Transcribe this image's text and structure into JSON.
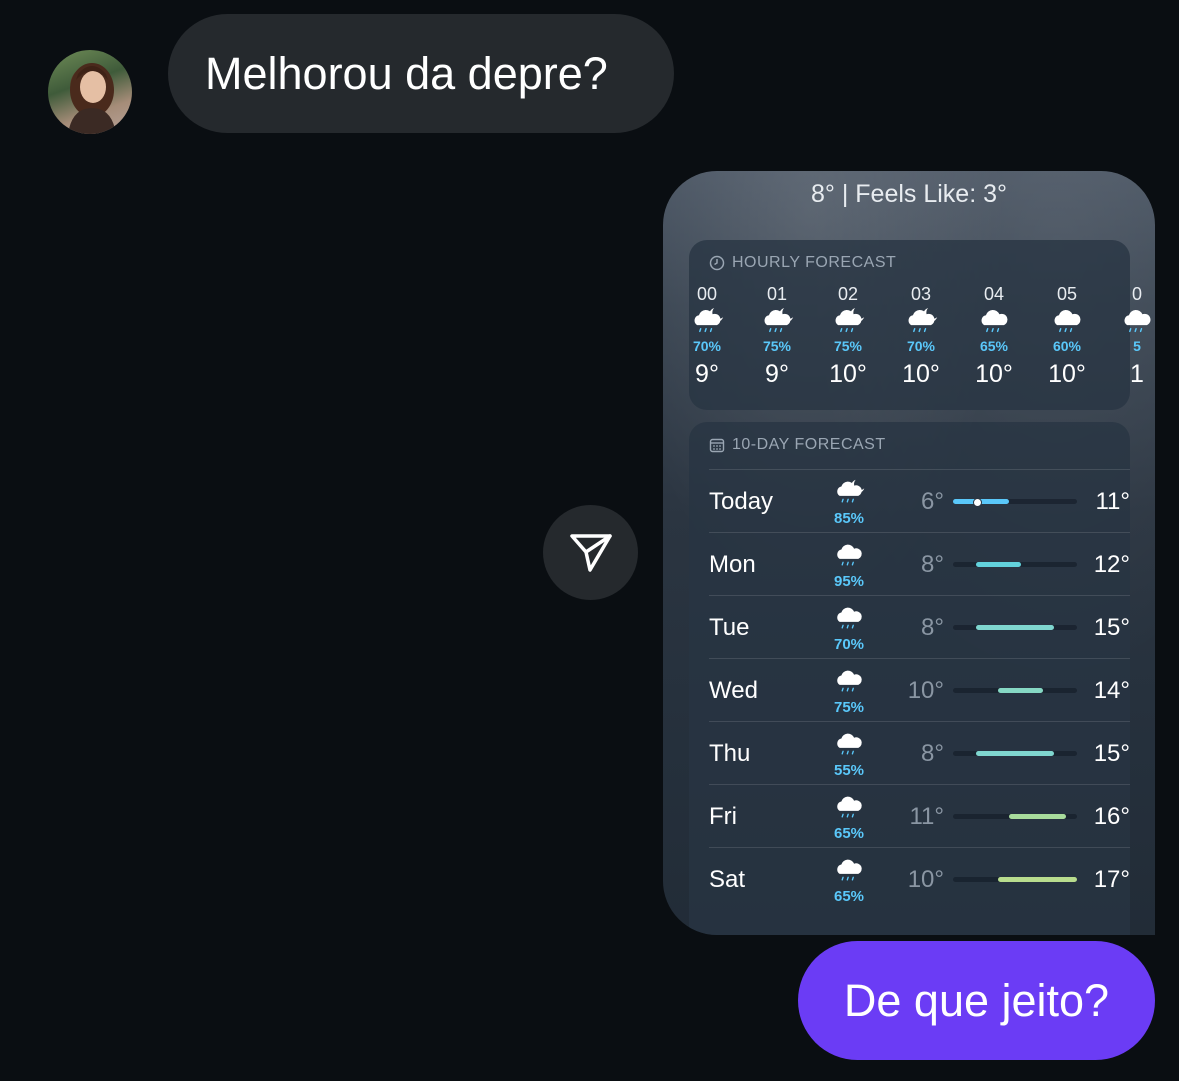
{
  "incoming_message": {
    "text": "Melhorou da depre?"
  },
  "outgoing_message": {
    "text": "De que jeito?"
  },
  "weather_card": {
    "current": "8° | Feels Like: 3°",
    "hourly": {
      "title": "HOURLY FORECAST",
      "items": [
        {
          "time": "00",
          "icon": "cloud-moon-rain-icon",
          "precip": "70%",
          "temp": "9°"
        },
        {
          "time": "01",
          "icon": "cloud-moon-rain-icon",
          "precip": "75%",
          "temp": "9°"
        },
        {
          "time": "02",
          "icon": "cloud-moon-rain-icon",
          "precip": "75%",
          "temp": "10°"
        },
        {
          "time": "03",
          "icon": "cloud-moon-rain-icon",
          "precip": "70%",
          "temp": "10°"
        },
        {
          "time": "04",
          "icon": "cloud-rain-icon",
          "precip": "65%",
          "temp": "10°"
        },
        {
          "time": "05",
          "icon": "cloud-rain-icon",
          "precip": "60%",
          "temp": "10°"
        },
        {
          "time": "0",
          "icon": "cloud-rain-icon",
          "precip": "5",
          "temp": "1"
        }
      ]
    },
    "daily": {
      "title": "10-DAY FORECAST",
      "scale_min": 6,
      "scale_max": 17,
      "items": [
        {
          "day": "Today",
          "icon": "cloud-moon-rain-icon",
          "precip": "85%",
          "low": "6°",
          "high": "11°",
          "low_val": 6,
          "high_val": 11,
          "color": "#5ac8fa",
          "current": 8
        },
        {
          "day": "Mon",
          "icon": "cloud-rain-icon",
          "precip": "95%",
          "low": "8°",
          "high": "12°",
          "low_val": 8,
          "high_val": 12,
          "color": "#62d2dc"
        },
        {
          "day": "Tue",
          "icon": "cloud-rain-icon",
          "precip": "70%",
          "low": "8°",
          "high": "15°",
          "low_val": 8,
          "high_val": 15,
          "color": "#7fd6cf"
        },
        {
          "day": "Wed",
          "icon": "cloud-rain-icon",
          "precip": "75%",
          "low": "10°",
          "high": "14°",
          "low_val": 10,
          "high_val": 14,
          "color": "#86d8c4"
        },
        {
          "day": "Thu",
          "icon": "cloud-rain-icon",
          "precip": "55%",
          "low": "8°",
          "high": "15°",
          "low_val": 8,
          "high_val": 15,
          "color": "#7fd6cf"
        },
        {
          "day": "Fri",
          "icon": "cloud-rain-icon",
          "precip": "65%",
          "low": "11°",
          "high": "16°",
          "low_val": 11,
          "high_val": 16,
          "color": "#a8dc9c"
        },
        {
          "day": "Sat",
          "icon": "cloud-rain-icon",
          "precip": "65%",
          "low": "10°",
          "high": "17°",
          "low_val": 10,
          "high_val": 17,
          "color": "#b8dd8e"
        }
      ]
    }
  }
}
